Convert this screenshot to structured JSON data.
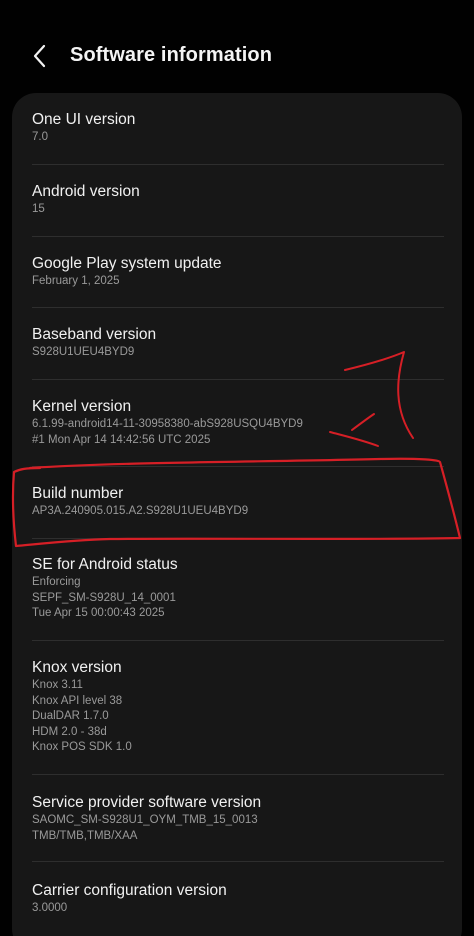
{
  "header": {
    "title": "Software information"
  },
  "items": [
    {
      "title": "One UI version",
      "lines": [
        "7.0"
      ]
    },
    {
      "title": "Android version",
      "lines": [
        "15"
      ]
    },
    {
      "title": "Google Play system update",
      "lines": [
        "February 1, 2025"
      ]
    },
    {
      "title": "Baseband version",
      "lines": [
        "S928U1UEU4BYD9"
      ]
    },
    {
      "title": "Kernel version",
      "lines": [
        "6.1.99-android14-11-30958380-abS928USQU4BYD9",
        "#1 Mon Apr 14 14:42:56 UTC 2025"
      ]
    },
    {
      "title": "Build number",
      "lines": [
        "AP3A.240905.015.A2.S928U1UEU4BYD9"
      ]
    },
    {
      "title": "SE for Android status",
      "lines": [
        "Enforcing",
        "SEPF_SM-S928U_14_0001",
        "Tue Apr 15 00:00:43 2025"
      ]
    },
    {
      "title": "Knox version",
      "lines": [
        "Knox 3.11",
        "Knox API level 38",
        "DualDAR 1.7.0",
        "HDM 2.0 - 38d",
        "Knox POS SDK 1.0"
      ]
    },
    {
      "title": "Service provider software version",
      "lines": [
        "SAOMC_SM-S928U1_OYM_TMB_15_0013",
        "TMB/TMB,TMB/XAA"
      ]
    },
    {
      "title": "Carrier configuration version",
      "lines": [
        "3.0000"
      ]
    }
  ],
  "colors": {
    "background": "#010101",
    "card": "#171717",
    "annotation": "#d61f26"
  },
  "icons": {
    "back": "chevron-left-icon"
  }
}
